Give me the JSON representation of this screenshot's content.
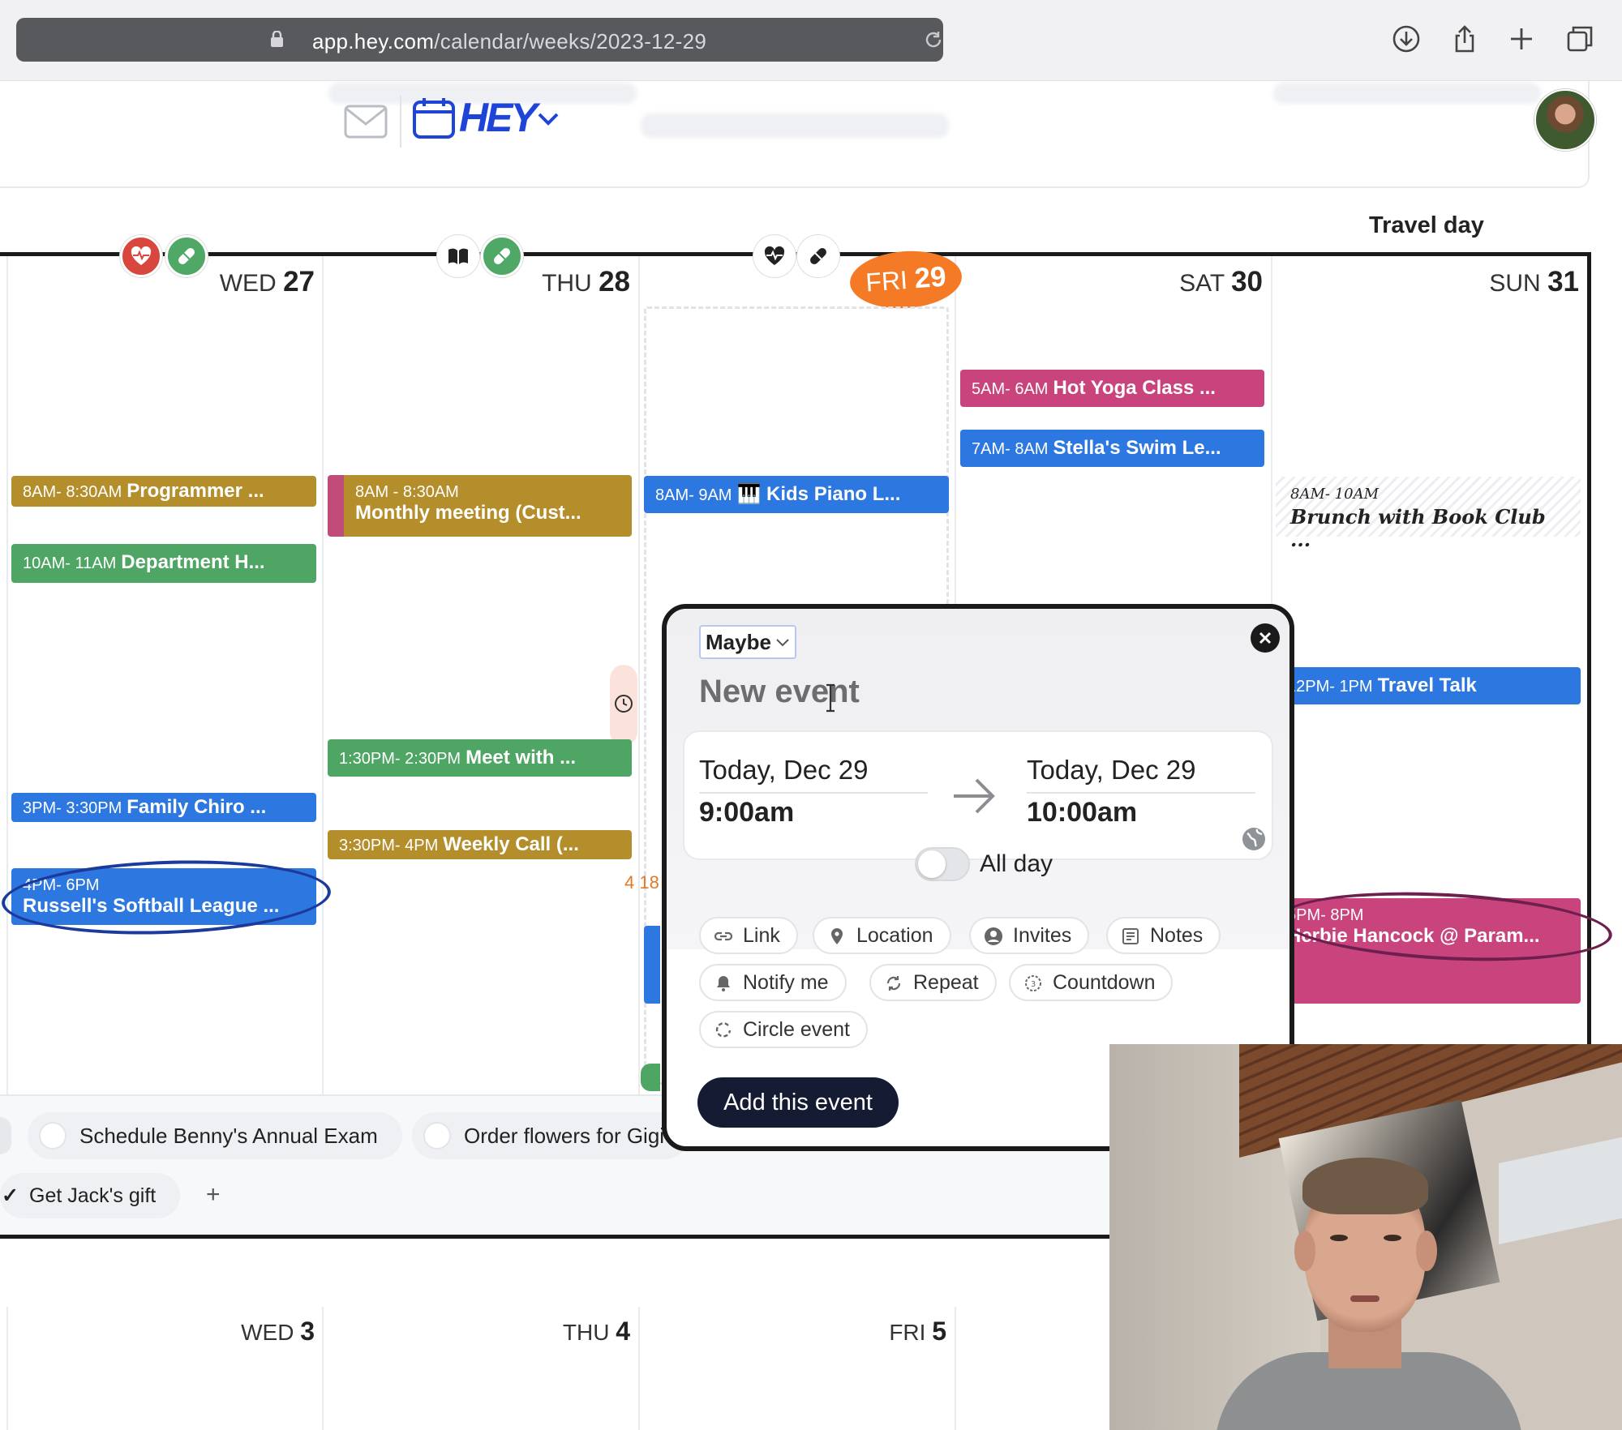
{
  "browser": {
    "url_host": "app.hey.com",
    "url_path": "/calendar/weeks/2023-12-29",
    "icons": [
      "lock-icon",
      "reload-icon",
      "download-icon",
      "share-icon",
      "new-tab-icon",
      "tabs-icon"
    ]
  },
  "header": {
    "logo_text": "HEY",
    "icons": [
      "mail-icon",
      "calendar-icon",
      "chevron-down-icon"
    ]
  },
  "week": {
    "banner": "Travel day",
    "days": [
      {
        "dow": "WED",
        "num": "27"
      },
      {
        "dow": "THU",
        "num": "28"
      },
      {
        "dow": "FRI",
        "num": "29",
        "today": true
      },
      {
        "dow": "SAT",
        "num": "30"
      },
      {
        "dow": "SUN",
        "num": "31"
      }
    ],
    "habits": {
      "wed": [
        "heart-rate-icon",
        "pill-icon"
      ],
      "thu": [
        "book-icon",
        "pill-icon"
      ],
      "fri": [
        "heart-rate-icon",
        "pill-icon"
      ]
    }
  },
  "events": {
    "wed_programmer": {
      "time": "8AM- 8:30AM",
      "title": "Programmer ..."
    },
    "wed_department": {
      "time": "10AM- 11AM",
      "title": "Department H..."
    },
    "wed_chiro": {
      "time": "3PM- 3:30PM",
      "title": "Family Chiro ..."
    },
    "wed_softball": {
      "time": "4PM- 6PM",
      "title": "Russell's Softball League ..."
    },
    "thu_monthly": {
      "time": "8AM - 8:30AM",
      "title": "Monthly meeting (Cust..."
    },
    "thu_meet": {
      "time": "1:30PM- 2:30PM",
      "title": "Meet with ..."
    },
    "thu_weekly": {
      "time": "3:30PM- 4PM",
      "title": "Weekly Call (..."
    },
    "thu_overflow": "4 18",
    "fri_piano": {
      "time": "8AM- 9AM",
      "title": "🎹 Kids Piano L..."
    },
    "sat_yoga": {
      "time": "5AM- 6AM",
      "title": "Hot Yoga Class ..."
    },
    "sat_swim": {
      "time": "7AM- 8AM",
      "title": "Stella's Swim Le..."
    },
    "sun_brunch": {
      "time": "8AM- 10AM",
      "title": "Brunch with Book Club ..."
    },
    "sun_travel": {
      "time": "12PM- 1PM",
      "title": "Travel Talk"
    },
    "sun_herbie": {
      "time": "5PM- 8PM",
      "title": "Herbie Hancock @ Param..."
    }
  },
  "tasks": {
    "items": [
      "Schedule Benny's Annual Exam",
      "Order flowers for Gigi"
    ],
    "done": "Get Jack's gift",
    "add_label": "+"
  },
  "next_week": [
    {
      "dow": "WED",
      "num": "3"
    },
    {
      "dow": "THU",
      "num": "4"
    },
    {
      "dow": "FRI",
      "num": "5"
    }
  ],
  "popup": {
    "status": "Maybe",
    "title_placeholder": "New event",
    "start_date": "Today, Dec 29",
    "start_time": "9:00am",
    "end_date": "Today, Dec 29",
    "end_time": "10:00am",
    "all_day_label": "All day",
    "all_day": false,
    "options": [
      {
        "label": "Link",
        "icon": "link-icon"
      },
      {
        "label": "Location",
        "icon": "location-icon"
      },
      {
        "label": "Invites",
        "icon": "person-icon"
      },
      {
        "label": "Notes",
        "icon": "notes-icon"
      },
      {
        "label": "Notify me",
        "icon": "bell-icon"
      },
      {
        "label": "Repeat",
        "icon": "repeat-icon"
      },
      {
        "label": "Countdown",
        "icon": "countdown-icon"
      },
      {
        "label": "Circle event",
        "icon": "circle-event-icon"
      }
    ],
    "submit_label": "Add this event"
  },
  "colors": {
    "today_orange": "#f47a26",
    "event_olive": "#b58e2c",
    "event_green": "#4ea564",
    "event_blue": "#2c78e0",
    "event_pink": "#c9447d",
    "hey_blue": "#1f45d8",
    "submit_navy": "#141b33"
  }
}
